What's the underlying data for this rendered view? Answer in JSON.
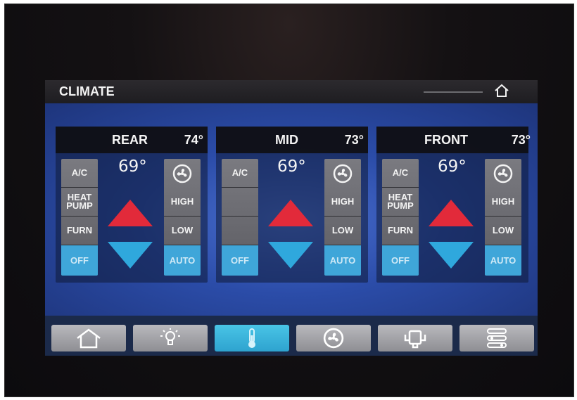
{
  "header": {
    "title": "CLIMATE",
    "home_icon": "home-icon"
  },
  "zones": [
    {
      "name": "REAR",
      "current_temp": "74°",
      "setpoint": "69°",
      "modes": [
        "A/C",
        "HEAT PUMP",
        "FURN",
        "OFF"
      ],
      "active_mode": "OFF",
      "fan": [
        "HIGH",
        "LOW",
        "AUTO"
      ],
      "active_fan": "AUTO"
    },
    {
      "name": "MID",
      "current_temp": "73°",
      "setpoint": "69°",
      "modes": [
        "A/C",
        "",
        "",
        "OFF"
      ],
      "active_mode": "OFF",
      "fan": [
        "HIGH",
        "LOW",
        "AUTO"
      ],
      "active_fan": "AUTO"
    },
    {
      "name": "FRONT",
      "current_temp": "73°",
      "setpoint": "69°",
      "modes": [
        "A/C",
        "HEAT PUMP",
        "FURN",
        "OFF"
      ],
      "active_mode": "OFF",
      "fan": [
        "HIGH",
        "LOW",
        "AUTO"
      ],
      "active_fan": "AUTO"
    }
  ],
  "nav": {
    "items": [
      "home-icon",
      "light-bulb-icon",
      "thermometer-icon",
      "fan-icon",
      "generator-icon",
      "settings-sliders-icon"
    ],
    "active": "thermometer-icon"
  },
  "colors": {
    "up_arrow": "#e22a3a",
    "down_arrow": "#2fa8dd",
    "active_button": "#3fa6d9",
    "nav_active": "#3bb6de"
  }
}
